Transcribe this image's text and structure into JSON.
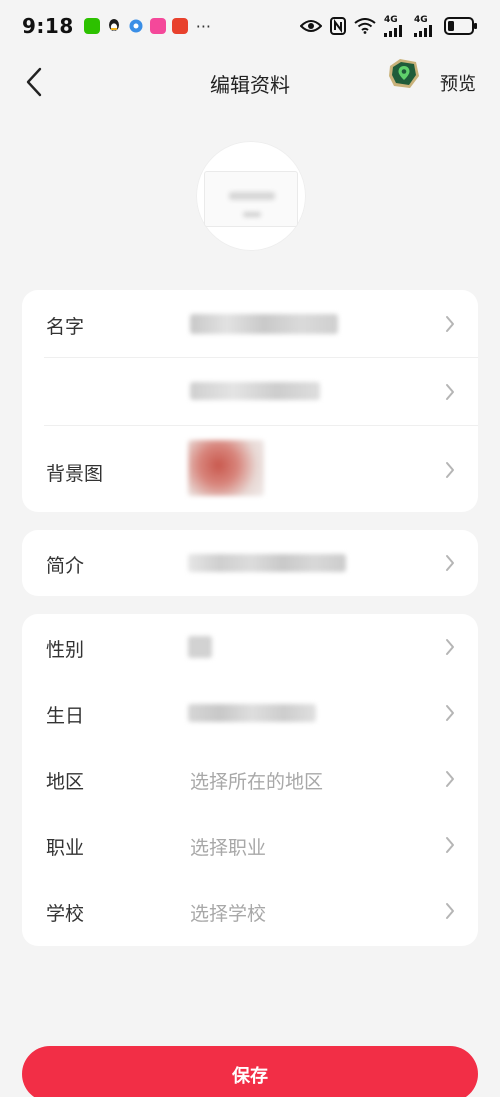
{
  "status_bar": {
    "time": "9:18",
    "more": "···",
    "signal_1_label": "4G",
    "signal_2_label": "4G",
    "colors": {
      "wechat": "#2dc100",
      "qq": "#1e1e1e",
      "browser": "#3a8ee6",
      "app_pink": "#f4489a",
      "app_red": "#e8412c"
    }
  },
  "header": {
    "title": "编辑资料",
    "preview": "预览",
    "back_icon": "chevron-left-icon",
    "badge_icon": "map-pin-badge-icon"
  },
  "profile": {
    "rows_group1": [
      {
        "label": "名字",
        "value_hidden": true
      },
      {
        "label": "",
        "value_hidden": true
      },
      {
        "label": "背景图",
        "value_type": "image-thumbnail"
      }
    ],
    "rows_group2": [
      {
        "label": "简介",
        "value_hidden": true
      }
    ],
    "rows_group3": [
      {
        "label": "性别",
        "value_hidden": true
      },
      {
        "label": "生日",
        "value_hidden": true
      },
      {
        "label": "地区",
        "placeholder": "选择所在的地区"
      },
      {
        "label": "职业",
        "placeholder": "选择职业"
      },
      {
        "label": "学校",
        "placeholder": "选择学校"
      }
    ]
  },
  "save_button": {
    "label": "保存"
  },
  "colors": {
    "accent": "#f22e46",
    "background": "#f4f4f4",
    "card": "#ffffff",
    "placeholder": "#a8a8a8"
  }
}
